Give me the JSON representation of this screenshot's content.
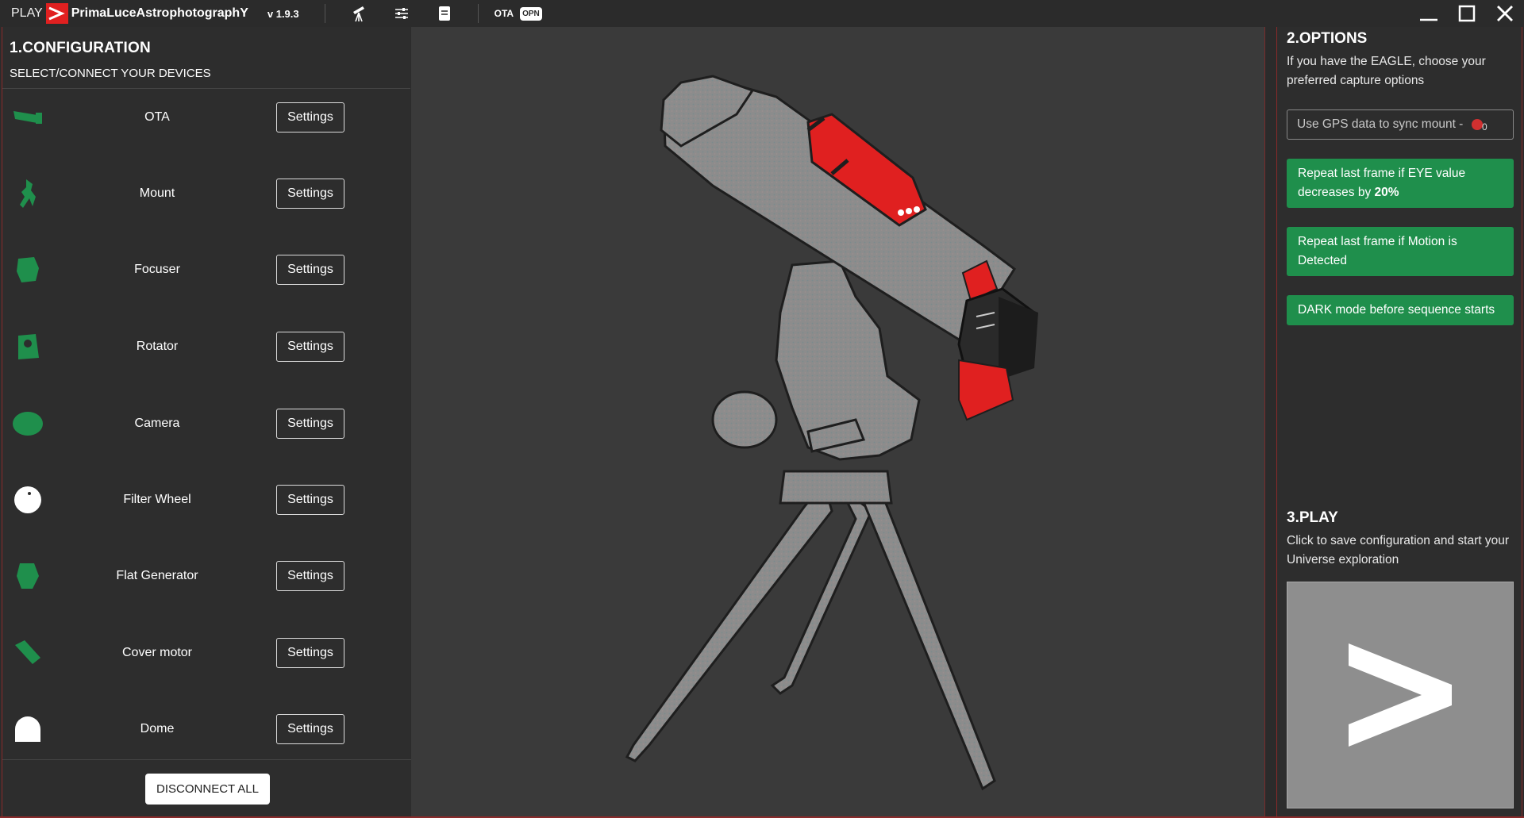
{
  "titlebar": {
    "play": "PLAY",
    "brand": "PrimaLuceAstrophotographY",
    "version": "v 1.9.3",
    "ota": "OTA",
    "opn": "OPN",
    "icons": [
      "telescope-icon",
      "sliders-icon",
      "document-icon"
    ],
    "window_controls": [
      "minimize-icon",
      "maximize-icon",
      "close-icon"
    ]
  },
  "config": {
    "title": "1.CONFIGURATION",
    "subtitle": "SELECT/CONNECT YOUR DEVICES",
    "settings_label": "Settings",
    "devices": [
      {
        "label": "OTA",
        "icon": "ota-icon",
        "color": "#1f8f4c"
      },
      {
        "label": "Mount",
        "icon": "mount-icon",
        "color": "#1f8f4c"
      },
      {
        "label": "Focuser",
        "icon": "focuser-icon",
        "color": "#1f8f4c"
      },
      {
        "label": "Rotator",
        "icon": "rotator-icon",
        "color": "#1f8f4c"
      },
      {
        "label": "Camera",
        "icon": "camera-icon",
        "color": "#1f8f4c"
      },
      {
        "label": "Filter Wheel",
        "icon": "filter-wheel-icon",
        "color": "#ffffff"
      },
      {
        "label": "Flat Generator",
        "icon": "flat-generator-icon",
        "color": "#1f8f4c"
      },
      {
        "label": "Cover motor",
        "icon": "cover-motor-icon",
        "color": "#1f8f4c"
      },
      {
        "label": "Dome",
        "icon": "dome-icon",
        "color": "#ffffff"
      }
    ],
    "disconnect_label": "DISCONNECT ALL"
  },
  "options": {
    "title": "2.OPTIONS",
    "description": "If you have the EAGLE, choose your preferred capture options",
    "gps_label": "Use GPS data to sync mount -",
    "gps_count": "0",
    "buttons": [
      {
        "text": "Repeat last frame if EYE value decreases by ",
        "bold": "20%"
      },
      {
        "text": "Repeat last frame if Motion is Detected",
        "bold": ""
      },
      {
        "text": "DARK mode before sequence starts",
        "bold": ""
      }
    ]
  },
  "play": {
    "title": "3.PLAY",
    "description": "Click to save configuration and start your Universe exploration",
    "button_icon": "play-arrow-icon"
  },
  "colors": {
    "accent_green": "#1f8f4c",
    "brand_red": "#e02020",
    "border_red": "#8a2a2a"
  }
}
